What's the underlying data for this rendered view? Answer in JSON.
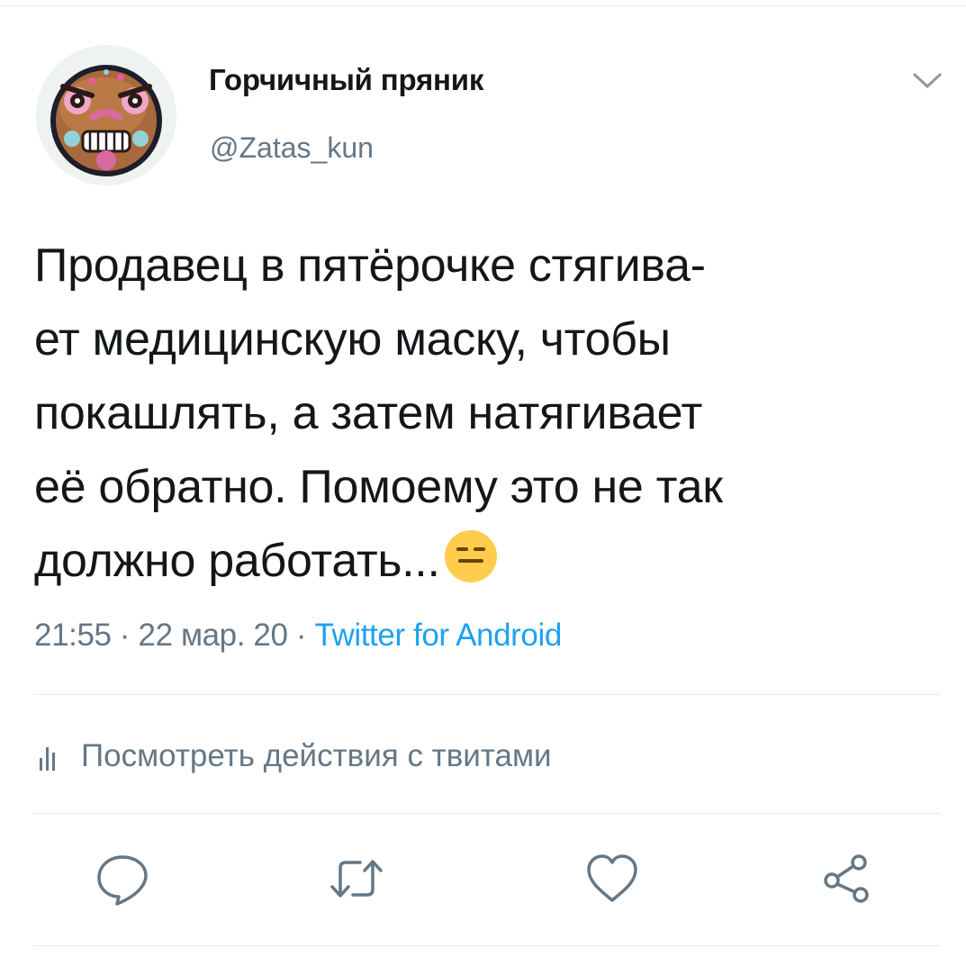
{
  "tweet": {
    "author": {
      "display_name": "Горчичный пряник",
      "handle": "@Zatas_kun"
    },
    "text": "Продавец в пятёрочке стягива-\nет медицинскую маску, чтобы\nпокашлять, а затем натягивает\nеё обратно. Помоему это не так\nдолжно работать...",
    "emoji": "expressionless-face",
    "time": "21:55",
    "date": "22 мар. 20",
    "separator": " · ",
    "source": "Twitter for Android"
  },
  "activity": {
    "label": "Посмотреть действия с твитами"
  },
  "actions": [
    "reply",
    "retweet",
    "like",
    "share"
  ],
  "colors": {
    "text": "#14171a",
    "secondary": "#657786",
    "accent": "#1da1f2",
    "divider": "#e6ecf0",
    "emoji": "#ffcc4d"
  }
}
